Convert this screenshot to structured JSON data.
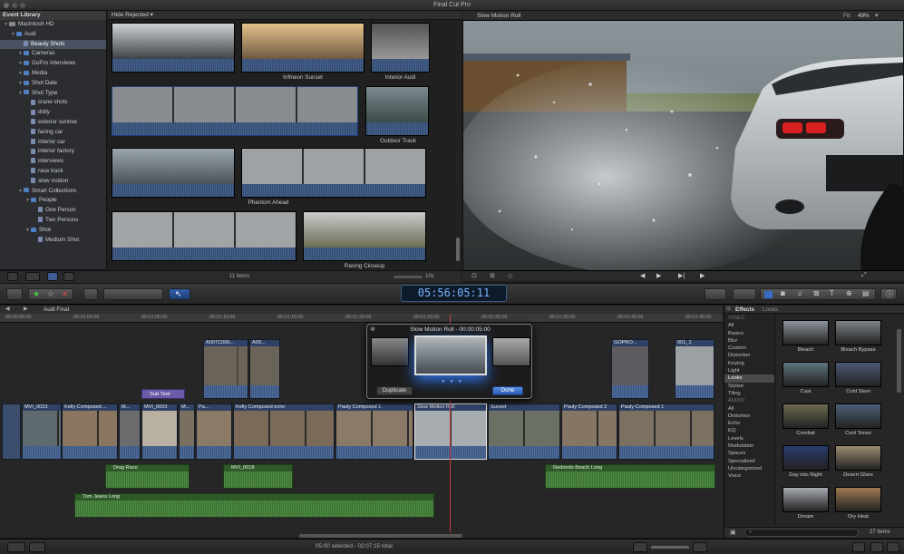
{
  "window": {
    "title": "Final Cut Pro"
  },
  "library": {
    "header": "Event Library",
    "items": [
      {
        "label": "Macintosh HD",
        "level": 0,
        "kind": "hd"
      },
      {
        "label": "Audi",
        "level": 1,
        "kind": "folder"
      },
      {
        "label": "Beauty Shots",
        "level": 2,
        "kind": "kw",
        "selected": true
      },
      {
        "label": "Cameras",
        "level": 2,
        "kind": "folder"
      },
      {
        "label": "GoPro Interviews",
        "level": 2,
        "kind": "folder"
      },
      {
        "label": "Media",
        "level": 2,
        "kind": "folder"
      },
      {
        "label": "Shot Date",
        "level": 2,
        "kind": "folder"
      },
      {
        "label": "Shot Type",
        "level": 2,
        "kind": "folder"
      },
      {
        "label": "crane shots",
        "level": 3,
        "kind": "kw"
      },
      {
        "label": "dolly",
        "level": 3,
        "kind": "kw"
      },
      {
        "label": "exterior sunrise",
        "level": 3,
        "kind": "kw"
      },
      {
        "label": "facing car",
        "level": 3,
        "kind": "kw"
      },
      {
        "label": "interior car",
        "level": 3,
        "kind": "kw"
      },
      {
        "label": "interior factory",
        "level": 3,
        "kind": "kw"
      },
      {
        "label": "interviews",
        "level": 3,
        "kind": "kw"
      },
      {
        "label": "race track",
        "level": 3,
        "kind": "kw"
      },
      {
        "label": "slow motion",
        "level": 3,
        "kind": "kw"
      },
      {
        "label": "Smart Collections",
        "level": 2,
        "kind": "folder"
      },
      {
        "label": "People",
        "level": 3,
        "kind": "folder"
      },
      {
        "label": "One Person",
        "level": 4,
        "kind": "kw"
      },
      {
        "label": "Two Persons",
        "level": 4,
        "kind": "kw"
      },
      {
        "label": "Shot",
        "level": 3,
        "kind": "folder"
      },
      {
        "label": "Medium Shot",
        "level": 4,
        "kind": "kw"
      }
    ]
  },
  "browser": {
    "filter": "Hide Rejected",
    "clip_labels": [
      "Infineon Sunset",
      "Interior Audi",
      "Outdoor Track",
      "Phantom Ahead",
      "Racing Closeup"
    ],
    "count": "11 items",
    "duration": "10s"
  },
  "viewer": {
    "title": "Slow Motion Roll",
    "fit_label": "Fit:",
    "fit_value": "49%"
  },
  "toolbar": {
    "timecode": "05:56:05:11"
  },
  "timeline": {
    "project": "Audi Final",
    "ruler": [
      "00:00:00:00",
      "00:01:00:00",
      "00:01:05:00",
      "00:01:10:00",
      "00:01:15:00",
      "00:01:20:00",
      "00:01:25:00",
      "00:01:30:00",
      "00:01:35:00",
      "00:01:40:00",
      "00:01:45:00"
    ],
    "primary_clips": [
      "MVI_0023",
      "Kelly Composed ...",
      "M...",
      "MVI_0003",
      "M...",
      "Pa...",
      "Kelly Composed echo",
      "Pauly Composed 1",
      "Slow Motion Roll",
      "Sunset",
      "Pauly Composed 2",
      "Pauly Composed 1"
    ],
    "connected_clips": [
      "A007C006...",
      "A00...",
      "GOPRO...",
      "001_1"
    ],
    "title_clip": "Sub Text",
    "audio_clips": [
      "Drag Race",
      "MVI_0018",
      "Redondo Beach Long",
      "Tom Jeans Long"
    ]
  },
  "popup": {
    "title": "Slow Motion Roll - 00:00:05:00",
    "duplicate": "Duplicate",
    "done": "Done"
  },
  "effects": {
    "tab_effects": "Effects",
    "tab_looks": "Looks",
    "categories": [
      {
        "label": "VIDEO",
        "section": true
      },
      {
        "label": "All"
      },
      {
        "label": "Basics"
      },
      {
        "label": "Blur"
      },
      {
        "label": "Custom"
      },
      {
        "label": "Distortion"
      },
      {
        "label": "Keying"
      },
      {
        "label": "Light"
      },
      {
        "label": "Looks",
        "selected": true
      },
      {
        "label": "Stylize"
      },
      {
        "label": "Tiling"
      },
      {
        "label": "AUDIO",
        "section": true
      },
      {
        "label": "All"
      },
      {
        "label": "Distortion"
      },
      {
        "label": "Echo"
      },
      {
        "label": "EQ"
      },
      {
        "label": "Levels"
      },
      {
        "label": "Modulation"
      },
      {
        "label": "Spaces"
      },
      {
        "label": "Specialized"
      },
      {
        "label": "Uncategorized"
      },
      {
        "label": "Voice"
      }
    ],
    "items": [
      {
        "label": "Bleach",
        "color": "#8d949b"
      },
      {
        "label": "Bleach Bypass",
        "color": "#7d8286"
      },
      {
        "label": "Cast",
        "color": "#5e7580"
      },
      {
        "label": "Cold Steel",
        "color": "#4b5a74"
      },
      {
        "label": "Combat",
        "color": "#6c6a50"
      },
      {
        "label": "Cool Tones",
        "color": "#4c6078"
      },
      {
        "label": "Day into Night",
        "color": "#283c6c"
      },
      {
        "label": "Desert Glare",
        "color": "#9c8b70"
      },
      {
        "label": "Dream",
        "color": "#a7aab0"
      },
      {
        "label": "Dry Heat",
        "color": "#a07a52"
      }
    ],
    "count": "27 items"
  },
  "status": {
    "selection": "05:00 selected - 02:07:15 total"
  }
}
